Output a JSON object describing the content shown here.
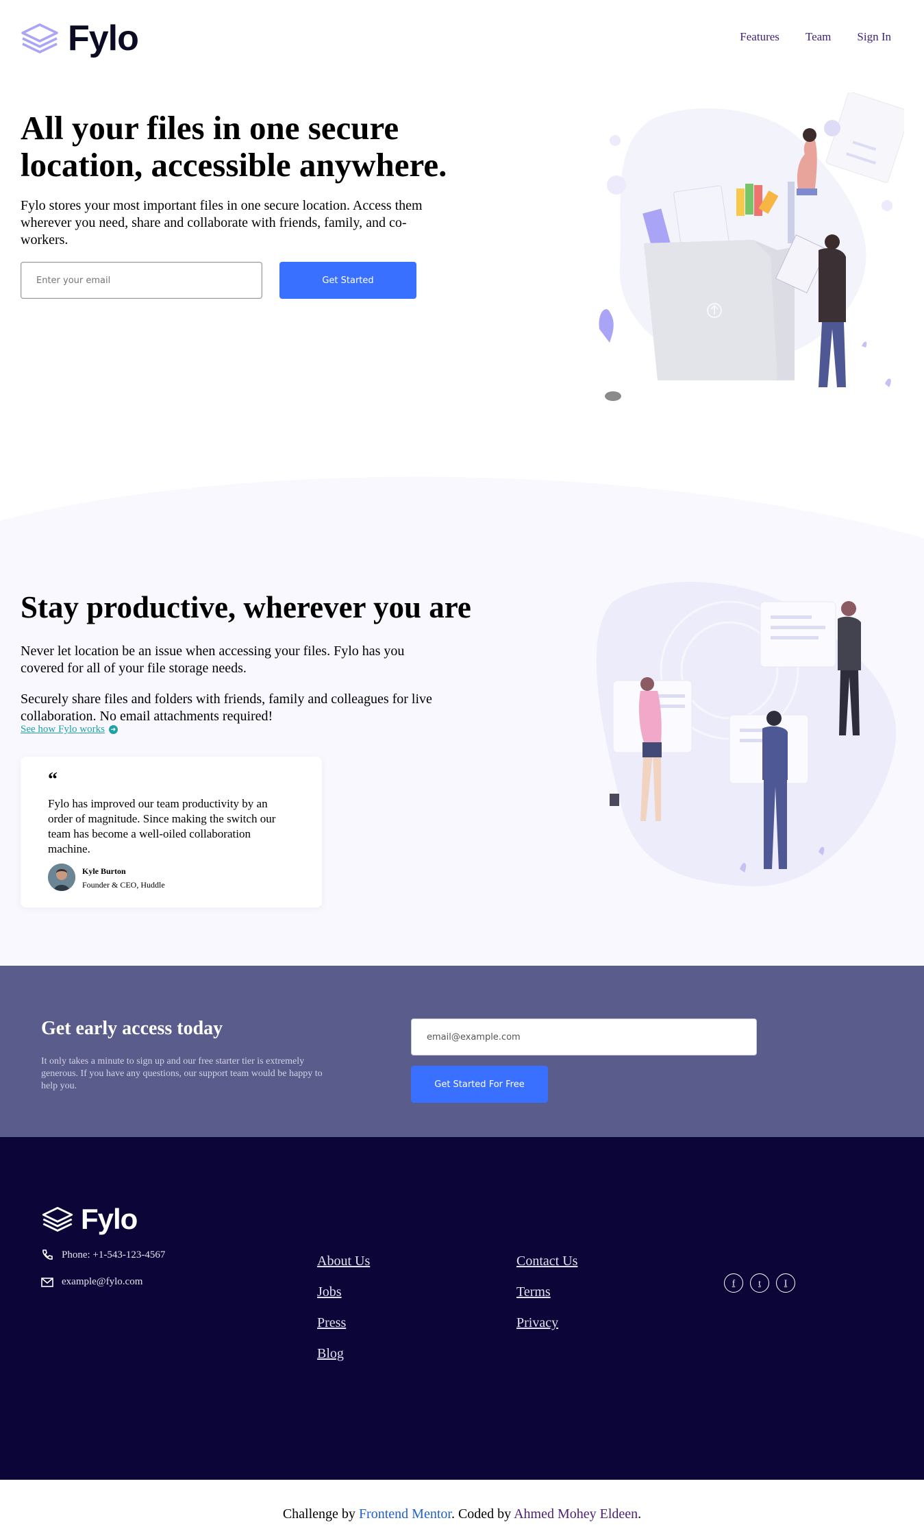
{
  "header": {
    "logo_text": "Fylo",
    "nav": [
      "Features",
      "Team",
      "Sign In"
    ]
  },
  "hero": {
    "title": "All your files in one secure location, accessible anywhere.",
    "description": "Fylo stores your most important files in one secure location. Access them wherever you need, share and collaborate with friends, family, and co-workers.",
    "email_placeholder": "Enter your email",
    "cta_label": "Get Started"
  },
  "productive": {
    "title": "Stay productive, wherever you are",
    "paragraph1": "Never let location be an issue when accessing your files. Fylo has you covered for all of your file storage needs.",
    "paragraph2": "Securely share files and folders with friends, family and colleagues for live collaboration. No email attachments required!",
    "link_label": "See how Fylo works",
    "testimonial": {
      "quote_mark": "“",
      "text": "Fylo has improved our team productivity by an order of magnitude. Since making the switch our team has become a well-oiled collaboration machine.",
      "author": "Kyle Burton",
      "role": "Founder & CEO, Huddle"
    }
  },
  "early_access": {
    "title": "Get early access today",
    "description": "It only takes a minute to sign up and our free starter tier is extremely generous. If you have any questions, our support team would be happy to help you.",
    "email_placeholder": "email@example.com",
    "cta_label": "Get Started For Free"
  },
  "footer": {
    "logo_text": "Fylo",
    "phone": "Phone: +1-543-123-4567",
    "email": "example@fylo.com",
    "links_col1": [
      "About Us",
      "Jobs",
      "Press",
      "Blog"
    ],
    "links_col2": [
      "Contact Us",
      "Terms",
      "Privacy"
    ],
    "socials": [
      "f",
      "t",
      "I"
    ]
  },
  "attribution": {
    "prefix": "Challenge by ",
    "fm": "Frontend Mentor",
    "middle": ". Coded by ",
    "coder": "Ahmed Mohey Eldeen",
    "suffix": "."
  },
  "colors": {
    "accent": "#3a70ff",
    "early_bg": "#5a5c8b",
    "footer_bg": "#0b0637",
    "link_teal": "#20a1a6"
  }
}
